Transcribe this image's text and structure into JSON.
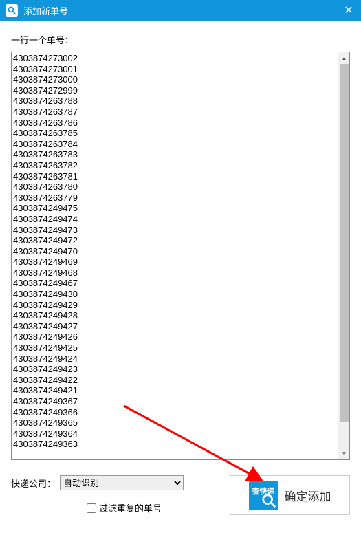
{
  "titlebar": {
    "title": "添加新单号",
    "close_glyph": "✕"
  },
  "main": {
    "instruction": "一行一个单号：",
    "numbers_text": "4303874273002\n4303874273001\n4303874273000\n4303874272999\n4303874263788\n4303874263787\n4303874263786\n4303874263785\n4303874263784\n4303874263783\n4303874263782\n4303874263781\n4303874263780\n4303874263779\n4303874249475\n4303874249474\n4303874249473\n4303874249472\n4303874249470\n4303874249469\n4303874249468\n4303874249467\n4303874249430\n4303874249429\n4303874249428\n4303874249427\n4303874249426\n4303874249425\n4303874249424\n4303874249423\n4303874249422\n4303874249421\n4303874249367\n4303874249366\n4303874249365\n4303874249364\n4303874249363"
  },
  "bottom": {
    "company_label": "快递公司：",
    "company_selected": "自动识别",
    "filter_label": "过滤重复的单号",
    "confirm_icon_text": "查快递",
    "confirm_label": "确定添加"
  }
}
